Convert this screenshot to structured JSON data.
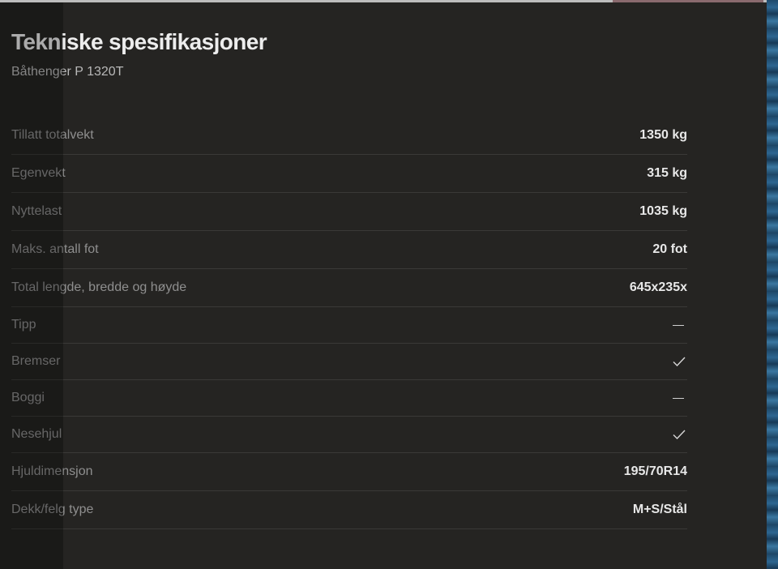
{
  "header": {
    "title": "Tekniske spesifikasjoner",
    "subtitle": "Båthenger P 1320T"
  },
  "specs": [
    {
      "label": "Tillatt totalvekt",
      "value": "1350 kg"
    },
    {
      "label": "Egenvekt",
      "value": "315 kg"
    },
    {
      "label": "Nyttelast",
      "value": "1035 kg"
    },
    {
      "label": "Maks. antall fot",
      "value": "20 fot"
    },
    {
      "label": "Total lengde, bredde og høyde",
      "value": "645x235x"
    },
    {
      "label": "Tipp",
      "indicator": "dash-icon"
    },
    {
      "label": "Bremser",
      "indicator": "check-icon"
    },
    {
      "label": "Boggi",
      "indicator": "dash-icon"
    },
    {
      "label": "Nesehjul",
      "indicator": "check-icon"
    },
    {
      "label": "Hjuldimensjon",
      "value": "195/70R14"
    },
    {
      "label": "Dekk/felg type",
      "value": "M+S/Stål"
    }
  ],
  "colors": {
    "panel_bg": "#252422",
    "title_text": "#ededed",
    "label_text": "#8f8f8f",
    "value_text": "#e8e8e8",
    "divider": "#3a3937"
  }
}
